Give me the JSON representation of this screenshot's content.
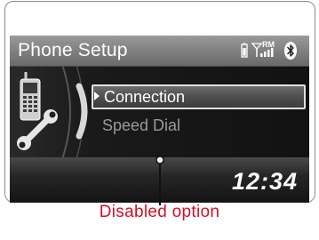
{
  "screen": {
    "title": "Phone Setup",
    "status_icons": [
      "battery-icon",
      "signal-icon",
      "roaming-indicator",
      "bluetooth-icon"
    ],
    "roaming_label": "RM",
    "menu": {
      "items": [
        {
          "label": "Connection",
          "state": "selected"
        },
        {
          "label": "Speed Dial",
          "state": "disabled"
        }
      ]
    },
    "clock": "12:34"
  },
  "annotation": {
    "caption": "Disabled option",
    "color": "#d01024"
  }
}
